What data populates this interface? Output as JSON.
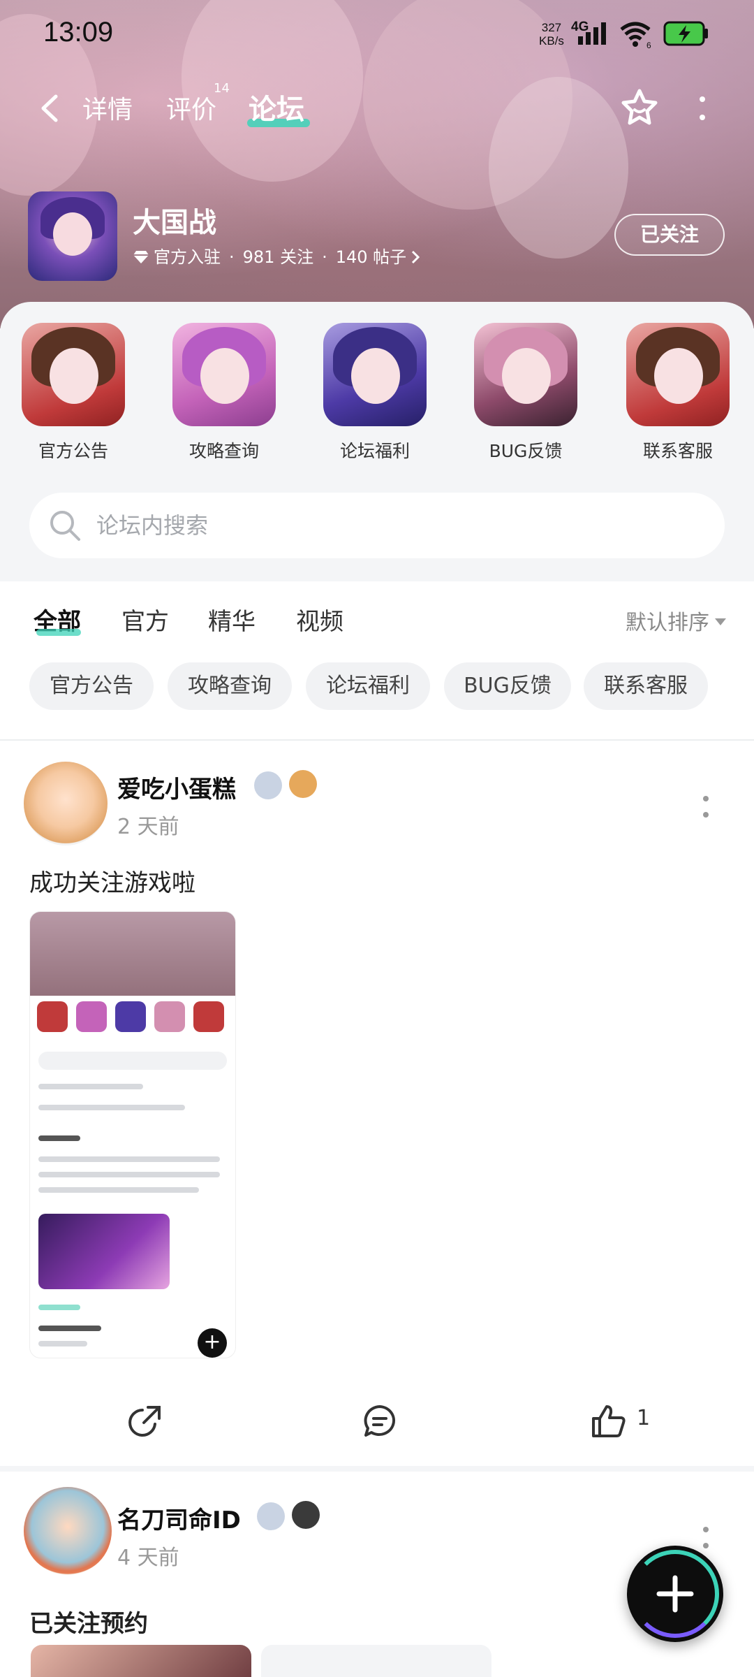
{
  "status_bar": {
    "time": "13:09",
    "net_speed": "327",
    "net_unit": "KB/s",
    "network": "4G",
    "wifi_sub": "6"
  },
  "nav": {
    "tabs": [
      {
        "label": "详情"
      },
      {
        "label": "评价",
        "badge": "14"
      },
      {
        "label": "论坛"
      }
    ],
    "active_tab": "论坛",
    "accent_color": "#3cd3b8"
  },
  "game": {
    "title": "大国战",
    "official": "官方入驻",
    "followers": "981 关注",
    "posts": "140 帖子",
    "follow_label": "已关注"
  },
  "categories": [
    {
      "label": "官方公告",
      "icon": "announcement-thumb"
    },
    {
      "label": "攻略查询",
      "icon": "guide-thumb"
    },
    {
      "label": "论坛福利",
      "icon": "welfare-thumb"
    },
    {
      "label": "BUG反馈",
      "icon": "bug-thumb"
    },
    {
      "label": "联系客服",
      "icon": "service-thumb"
    }
  ],
  "search": {
    "placeholder": "论坛内搜索"
  },
  "filters": {
    "tabs": [
      "全部",
      "官方",
      "精华",
      "视频"
    ],
    "active": "全部",
    "sort_label": "默认排序",
    "chips": [
      "官方公告",
      "攻略查询",
      "论坛福利",
      "BUG反馈",
      "联系客服"
    ]
  },
  "posts": [
    {
      "author": "爱吃小蛋糕",
      "time": "2 天前",
      "text": "成功关注游戏啦",
      "like_count": "1"
    },
    {
      "author": "名刀司命ID",
      "time": "4 天前",
      "text": "已关注预约"
    }
  ]
}
